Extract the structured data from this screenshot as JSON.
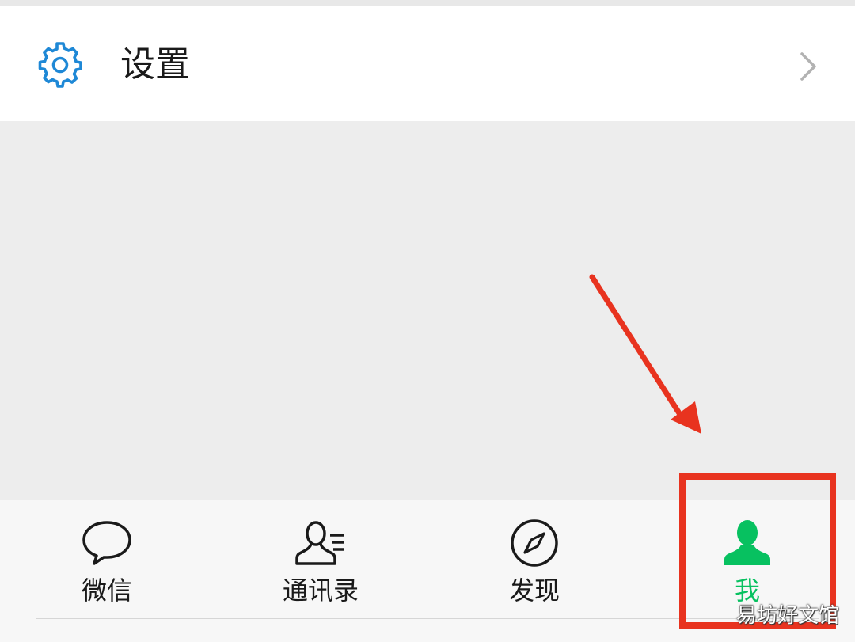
{
  "settings": {
    "label": "设置",
    "icon": "gear-icon",
    "chevron": "chevron-right-icon"
  },
  "tabbar": {
    "tabs": [
      {
        "label": "微信",
        "icon": "chat-bubble-icon",
        "active": false
      },
      {
        "label": "通讯录",
        "icon": "contacts-icon",
        "active": false
      },
      {
        "label": "发现",
        "icon": "compass-icon",
        "active": false
      },
      {
        "label": "我",
        "icon": "person-icon",
        "active": true
      }
    ]
  },
  "annotation": {
    "arrow": "red-arrow-pointing-to-me-tab",
    "box": "red-highlight-box"
  },
  "watermark": {
    "text": "易坊好文馆"
  },
  "colors": {
    "accent_green": "#07c160",
    "gear_blue": "#1e88d6",
    "annotation_red": "#e8331f",
    "background": "#ededed"
  }
}
